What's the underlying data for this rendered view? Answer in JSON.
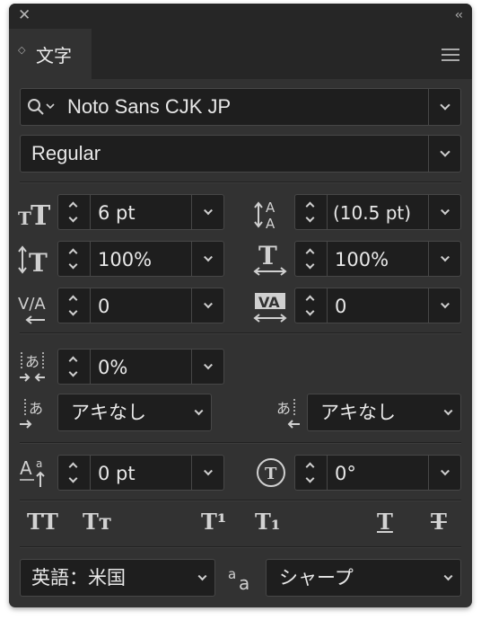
{
  "window": {
    "close_glyph": "✕",
    "collapse_glyph": "‹‹"
  },
  "tab": {
    "label": "文字"
  },
  "font": {
    "family": "Noto Sans CJK JP",
    "style": "Regular"
  },
  "metrics": {
    "size": "6 pt",
    "leading": "(10.5 pt)",
    "vertical_scale": "100%",
    "horizontal_scale": "100%",
    "kerning": "0",
    "tracking": "0",
    "tsume": "0%",
    "aki_left": "アキなし",
    "aki_right": "アキなし",
    "baseline_shift": "0 pt",
    "rotation": "0°"
  },
  "icons": {
    "search": "search-icon",
    "font_size": "font-size-icon",
    "leading": "leading-icon",
    "vertical_scale": "vertical-scale-icon",
    "horizontal_scale": "horizontal-scale-icon",
    "kerning": "kerning-icon",
    "tracking": "tracking-icon",
    "tsume": "tsume-icon",
    "aki_insert_left": "aki-insert-left-icon",
    "aki_insert_right": "aki-insert-right-icon",
    "baseline_shift": "baseline-shift-icon",
    "rotation": "character-rotation-icon",
    "anti_alias": "anti-alias-icon"
  },
  "format_buttons": {
    "all_caps": "TT",
    "small_caps": "Tт",
    "superscript": "T¹",
    "subscript": "T₁",
    "underline": "T",
    "strikethrough": "T"
  },
  "language": "英語：米国",
  "anti_alias": "シャープ"
}
